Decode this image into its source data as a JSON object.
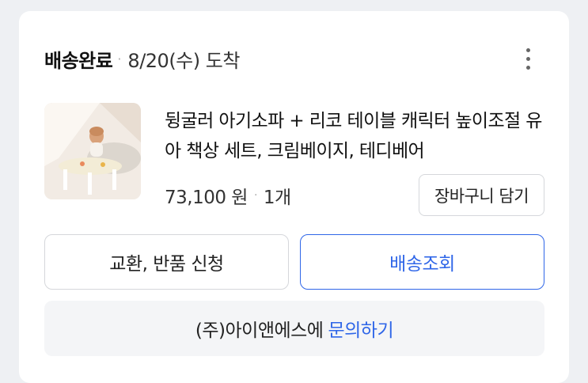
{
  "order": {
    "status": "배송완료",
    "separator": "·",
    "arrival": "8/20(수) 도착",
    "more_icon": "more-vertical-icon"
  },
  "product": {
    "title": "뒹굴러 아기소파 + 리코 테이블 캐릭터 높이조절 유아 책상 세트, 크림베이지, 테디베어",
    "price": "73,100 원",
    "separator": "·",
    "quantity": "1개",
    "cart_button": "장바구니 담기"
  },
  "actions": {
    "exchange_return": "교환, 반품 신청",
    "track_delivery": "배송조회"
  },
  "inquiry": {
    "seller": "(주)아이앤에스에",
    "link": "문의하기"
  },
  "colors": {
    "accent": "#2f66e8",
    "border": "#d5d7db",
    "inquiry_bg": "#f4f5f7"
  }
}
